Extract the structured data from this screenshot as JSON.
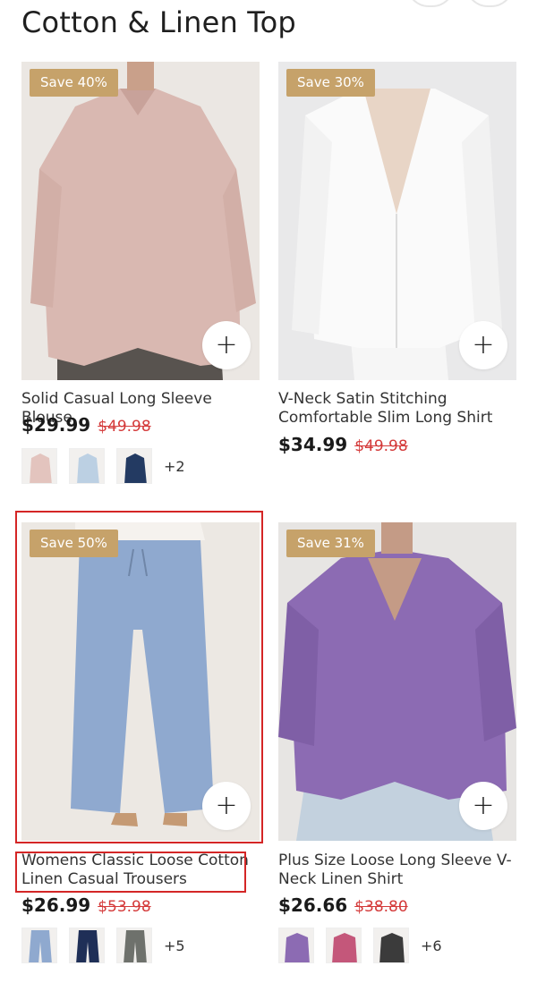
{
  "page": {
    "title": "Cotton & Linen Top"
  },
  "products": [
    {
      "name": "Solid Casual Long Sleeve Blouse",
      "badge": "Save 40%",
      "price": "$29.99",
      "old_price": "$49.98",
      "more_colors": "+2",
      "image_icon": "pink-blouse-image",
      "swatch_colors": [
        "#e3c4be",
        "#bcd0e3",
        "#233a62"
      ]
    },
    {
      "name": "V-Neck Satin Stitching Comfortable Slim Long Shirt",
      "badge": "Save 30%",
      "price": "$34.99",
      "old_price": "$49.98",
      "image_icon": "white-shirt-image"
    },
    {
      "name": "Womens Classic Loose Cotton Linen Casual Trousers",
      "badge": "Save 50%",
      "price": "$26.99",
      "old_price": "$53.98",
      "more_colors": "+5",
      "image_icon": "blue-trousers-image",
      "swatch_colors": [
        "#8fa9cf",
        "#1f2f57",
        "#6e716c"
      ]
    },
    {
      "name": "Plus Size Loose Long Sleeve V-Neck Linen Shirt",
      "badge": "Save 31%",
      "price": "$26.66",
      "old_price": "$38.80",
      "more_colors": "+6",
      "image_icon": "purple-shirt-image",
      "swatch_colors": [
        "#8c6bb3",
        "#c4577a",
        "#3b3b3b"
      ]
    }
  ],
  "colors": {
    "badge": "#c6a26a",
    "old_price": "#d43a3a",
    "highlight": "#d42626"
  }
}
